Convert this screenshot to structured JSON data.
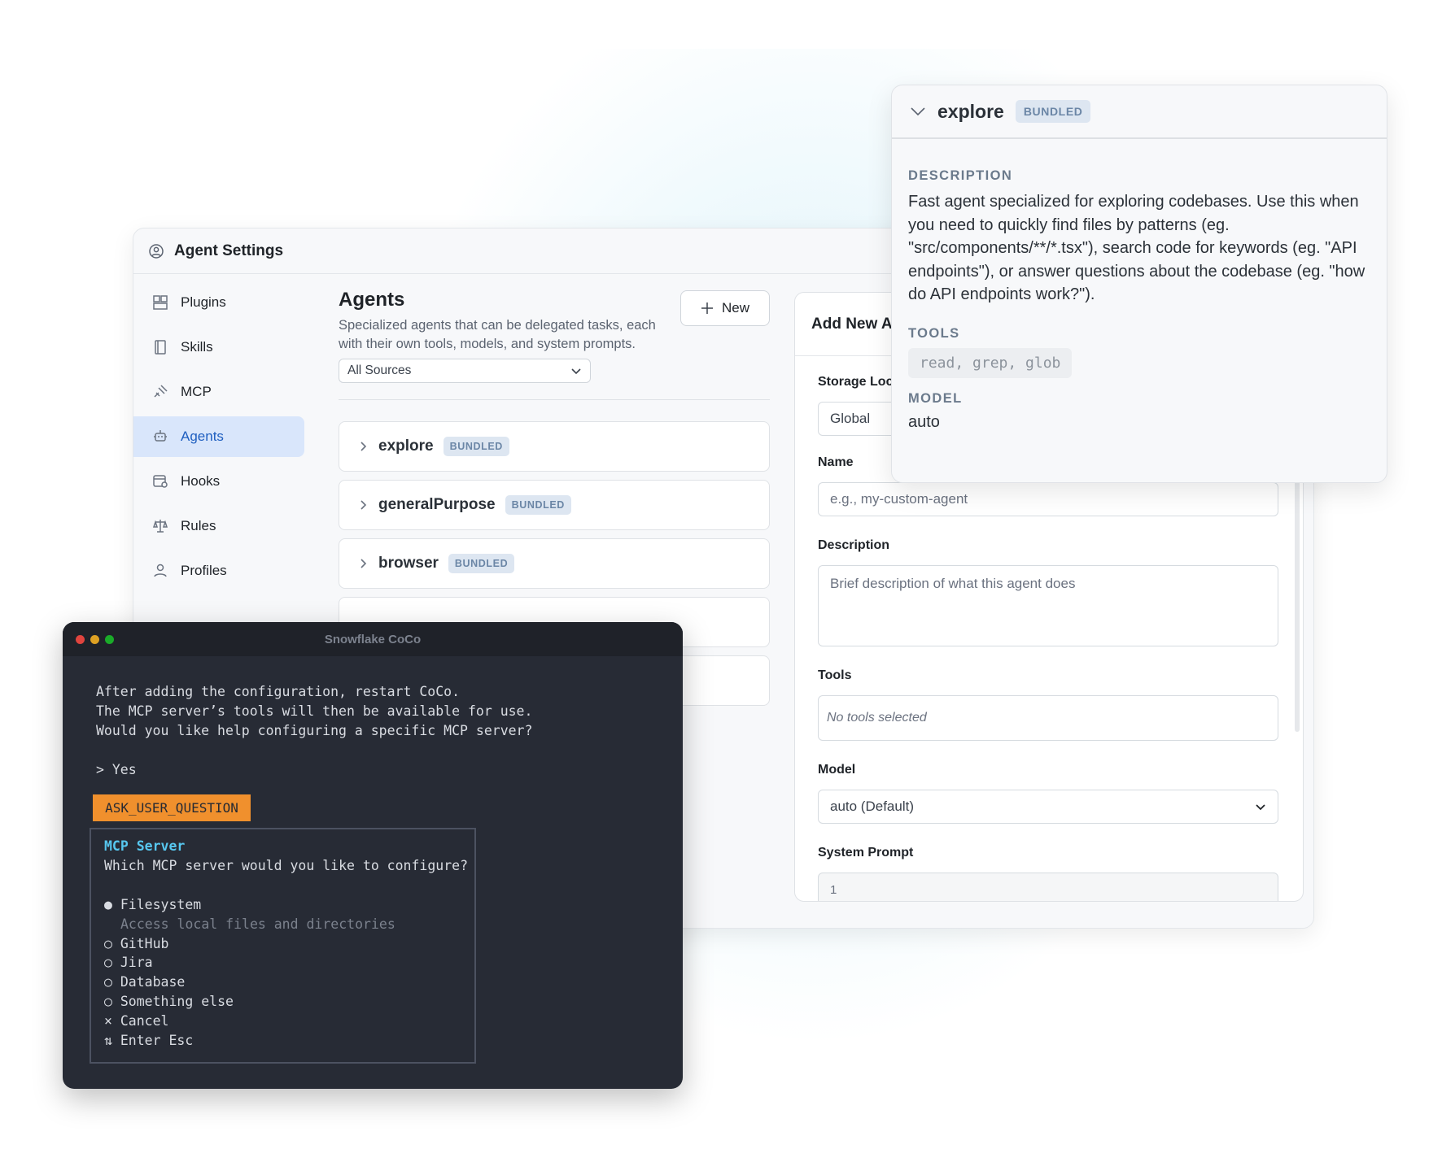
{
  "settings": {
    "title": "Agent Settings",
    "sidebar": [
      {
        "label": "Plugins",
        "icon": "puzzle-icon"
      },
      {
        "label": "Skills",
        "icon": "book-icon"
      },
      {
        "label": "MCP",
        "icon": "plug-icon"
      },
      {
        "label": "Agents",
        "icon": "robot-icon",
        "active": true
      },
      {
        "label": "Hooks",
        "icon": "hook-icon"
      },
      {
        "label": "Rules",
        "icon": "scale-icon"
      },
      {
        "label": "Profiles",
        "icon": "user-icon"
      }
    ],
    "agents": {
      "title": "Agents",
      "description": "Specialized agents that can be delegated tasks, each with their own tools, models, and system prompts.",
      "new_label": "New",
      "source_filter": "All Sources",
      "list": [
        {
          "name": "explore",
          "badge": "BUNDLED"
        },
        {
          "name": "generalPurpose",
          "badge": "BUNDLED"
        },
        {
          "name": "browser",
          "badge": "BUNDLED"
        }
      ]
    },
    "form": {
      "title": "Add New Agent",
      "storage_label": "Storage Location",
      "storage_value": "Global",
      "name_label": "Name",
      "name_placeholder": "e.g., my-custom-agent",
      "description_label": "Description",
      "description_placeholder": "Brief description of what this agent does",
      "tools_label": "Tools",
      "tools_value": "No tools selected",
      "model_label": "Model",
      "model_value": "auto (Default)",
      "system_prompt_label": "System Prompt",
      "system_prompt_line": "1"
    }
  },
  "popover": {
    "name": "explore",
    "badge": "BUNDLED",
    "description_label": "DESCRIPTION",
    "description": "Fast agent specialized for exploring codebases. Use this when you need to quickly find files by patterns (eg. \"src/components/**/*.tsx\"), search code for keywords (eg. \"API endpoints\"), or answer questions about the codebase (eg. \"how do API endpoints work?\").",
    "tools_label": "TOOLS",
    "tools": "read, grep, glob",
    "model_label": "MODEL",
    "model": "auto"
  },
  "terminal": {
    "title": "Snowflake CoCo",
    "line1": "After adding the configuration, restart CoCo.",
    "line2": "The MCP server’s tools will then be available for use.",
    "line3": "Would you like help configuring a specific MCP server?",
    "answer": "> Yes",
    "tag": "ASK_USER_QUESTION",
    "question_title": "MCP Server",
    "question": "Which MCP server would you like to configure?",
    "options": [
      {
        "marker": "●",
        "label": "Filesystem"
      },
      {
        "marker": "○",
        "label": "GitHub"
      },
      {
        "marker": "○",
        "label": "Jira"
      },
      {
        "marker": "○",
        "label": "Database"
      },
      {
        "marker": "○",
        "label": "Something else"
      },
      {
        "marker": "×",
        "label": "Cancel"
      }
    ],
    "option_hint": "Access local files and directories",
    "footer": "⇅ Enter Esc"
  },
  "colors": {
    "accent": "#1f5fc0",
    "active_bg": "#d9e6fb",
    "terminal_bg": "#272b35",
    "tag_orange": "#f0902d",
    "question_title": "#57c7ef"
  }
}
